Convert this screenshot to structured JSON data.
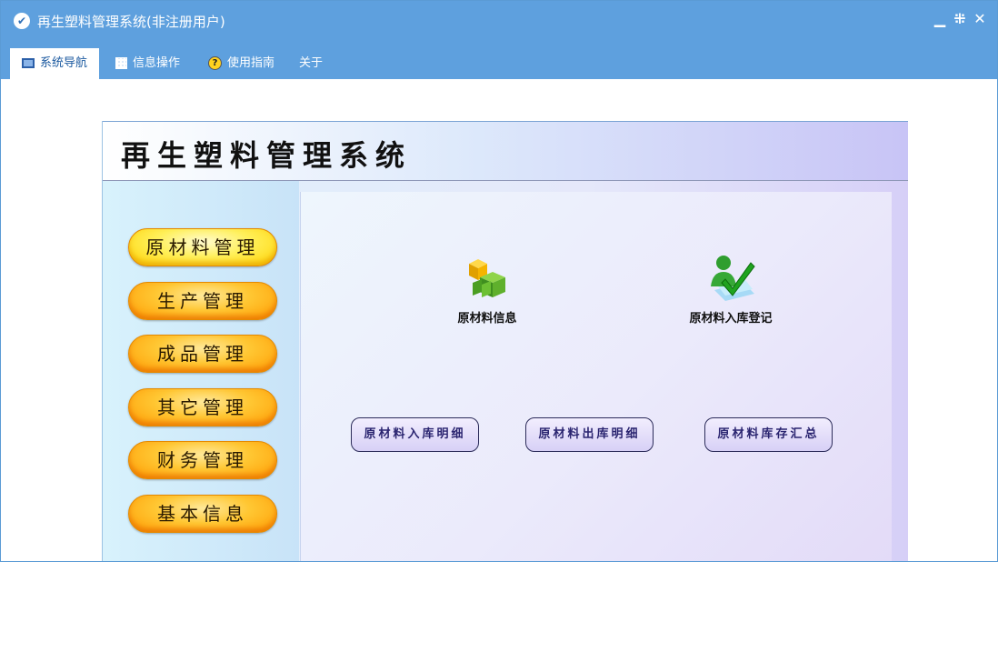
{
  "window": {
    "title": "再生塑料管理系统(非注册用户)",
    "app_icon_glyph": "✔",
    "controls": {
      "minimize": "▁",
      "restore": "⁜",
      "close": "✕"
    }
  },
  "menu": {
    "items": [
      {
        "label": "系统导航",
        "icon": "nav-window-icon"
      },
      {
        "label": "信息操作",
        "icon": "grid-icon"
      },
      {
        "label": "使用指南",
        "icon": "help-icon"
      },
      {
        "label": "关于"
      }
    ],
    "active": "系统导航"
  },
  "banner": {
    "title": "再生塑料管理系统"
  },
  "sidebar": {
    "items": [
      {
        "label": "原材料管理",
        "selected": true
      },
      {
        "label": "生产管理"
      },
      {
        "label": "成品管理"
      },
      {
        "label": "其它管理"
      },
      {
        "label": "财务管理"
      },
      {
        "label": "基本信息"
      }
    ]
  },
  "content": {
    "features": [
      {
        "label": "原材料信息",
        "icon": "green-cubes-icon"
      },
      {
        "label": "原材料入库登记",
        "icon": "user-checkmark-icon"
      }
    ],
    "buttons": [
      {
        "label": "原材料入库明细"
      },
      {
        "label": "原材料出库明细"
      },
      {
        "label": "原材料库存汇总"
      }
    ]
  },
  "colors": {
    "titlebar": "#5ea0de",
    "accent_orange": "#ff9a00",
    "selected_yellow": "#ffd200"
  }
}
